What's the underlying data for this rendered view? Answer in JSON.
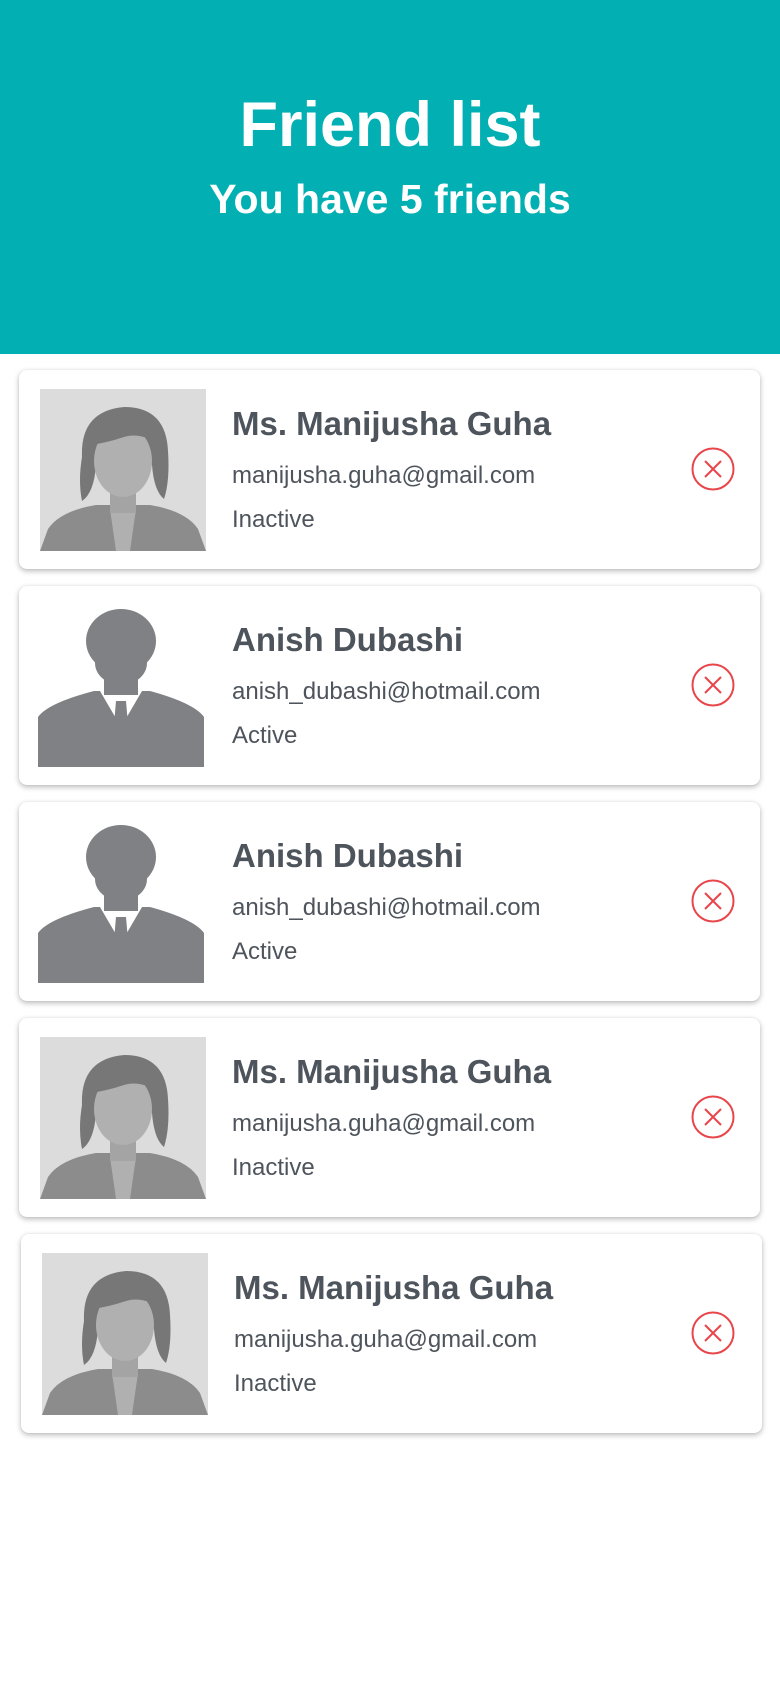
{
  "header": {
    "title": "Friend list",
    "subtitle": "You have 5 friends",
    "background_color": "#02afb3"
  },
  "friends": [
    {
      "name": "Ms. Manijusha Guha",
      "email": "manijusha.guha@gmail.com",
      "status": "Inactive",
      "avatar": "female-avatar",
      "remove_icon": "close-circle-icon"
    },
    {
      "name": "Anish Dubashi",
      "email": "anish_dubashi@hotmail.com",
      "status": "Active",
      "avatar": "male-avatar",
      "remove_icon": "close-circle-icon"
    },
    {
      "name": "Anish Dubashi",
      "email": "anish_dubashi@hotmail.com",
      "status": "Active",
      "avatar": "male-avatar",
      "remove_icon": "close-circle-icon"
    },
    {
      "name": "Ms. Manijusha Guha",
      "email": "manijusha.guha@gmail.com",
      "status": "Inactive",
      "avatar": "female-avatar",
      "remove_icon": "close-circle-icon"
    },
    {
      "name": "Ms. Manijusha Guha",
      "email": "manijusha.guha@gmail.com",
      "status": "Inactive",
      "avatar": "female-avatar",
      "remove_icon": "close-circle-icon"
    }
  ],
  "colors": {
    "text": "#4e545c",
    "remove_icon": "#e8464b",
    "card_background": "#ffffff"
  }
}
